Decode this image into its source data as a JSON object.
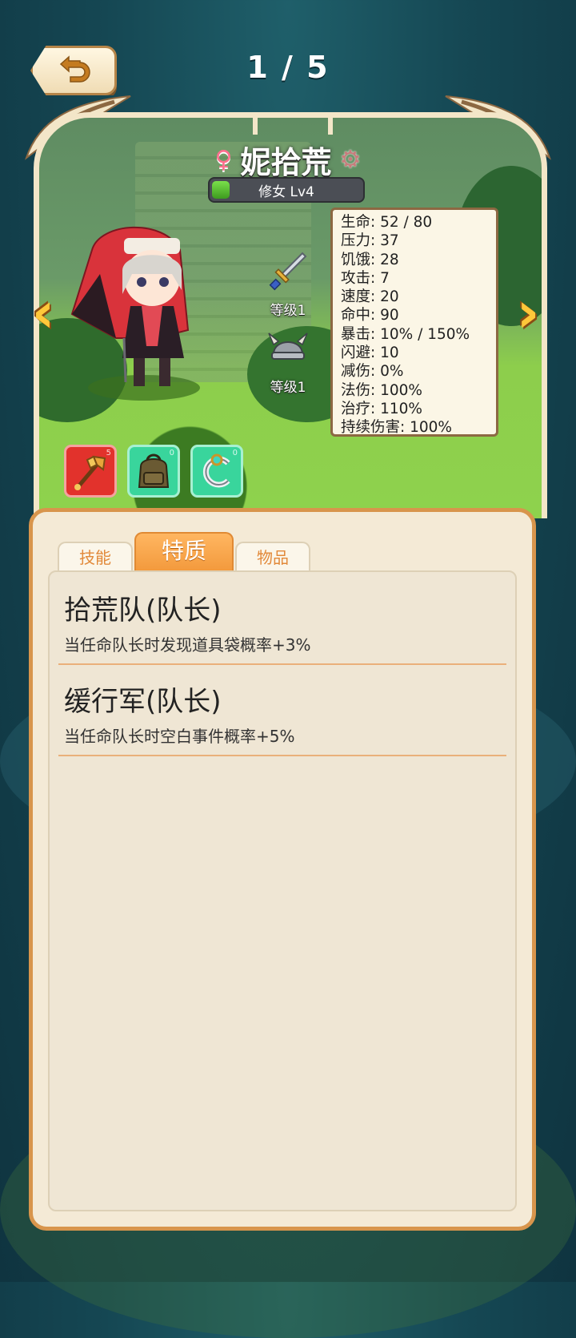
{
  "header": {
    "page_indicator": "1 / 5",
    "back_icon": "back-arrow-icon"
  },
  "character": {
    "gender_icon": "female-icon",
    "name": "妮拾荒",
    "class_level": "修女 Lv4",
    "equipment": [
      {
        "icon": "sword-icon",
        "level_label": "等级1"
      },
      {
        "icon": "helmet-icon",
        "level_label": "等级1"
      }
    ],
    "stats": [
      "生命: 52 / 80",
      "压力: 37",
      "饥饿: 28",
      "攻击: 7",
      "速度: 20",
      "命中: 90",
      "暴击: 10% / 150%",
      "闪避: 10",
      "减伤: 0%",
      "法伤: 100%",
      "治疗: 110%",
      "持续伤害: 100%"
    ],
    "items": [
      {
        "icon": "scepter-icon",
        "color": "#e2322c",
        "count": "5"
      },
      {
        "icon": "backpack-icon",
        "color": "#39d59c",
        "count": "0"
      },
      {
        "icon": "ring-icon",
        "color": "#39d59c",
        "count": "0"
      }
    ]
  },
  "tabs": [
    {
      "label": "技能",
      "active": false
    },
    {
      "label": "特质",
      "active": true
    },
    {
      "label": "物品",
      "active": false
    }
  ],
  "traits": [
    {
      "title": "拾荒队(队长)",
      "description": "当任命队长时发现道具袋概率+3%"
    },
    {
      "title": "缓行军(队长)",
      "description": "当任命队长时空白事件概率+5%"
    }
  ],
  "colors": {
    "accent": "#f39a3d",
    "panel_border": "#d8954c",
    "arrow": "#ffc83a"
  }
}
